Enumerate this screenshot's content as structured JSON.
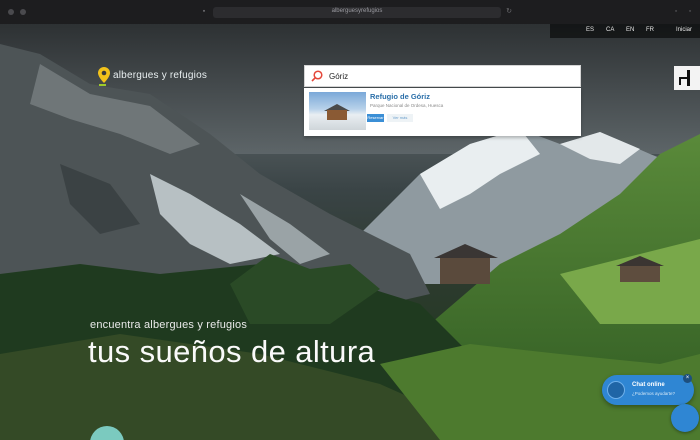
{
  "browser": {
    "address": "alberguesyrefugios"
  },
  "site": {
    "brand_label": "albergues y refugios",
    "nav_items": [
      "ES",
      "CA",
      "EN",
      "FR"
    ],
    "corner_label": "Iniciar"
  },
  "search": {
    "query": "Góriz",
    "placeholder": ""
  },
  "result": {
    "name": "Refugio de Góriz",
    "location": "Parque Nacional de Ordesa, Huesca",
    "primary_label": "Reservar",
    "secondary_label": "Ver más"
  },
  "hero": {
    "tagline": "encuentra albergues y refugios",
    "headline": "tus sueños de altura"
  },
  "chat": {
    "title": "Chat online",
    "subtitle": "¿Podemos ayudarte?",
    "close_glyph": "×"
  },
  "colors": {
    "accent": "#2f86d3",
    "brand_green": "#9ecb2a",
    "pin_yellow": "#f2c21b"
  }
}
